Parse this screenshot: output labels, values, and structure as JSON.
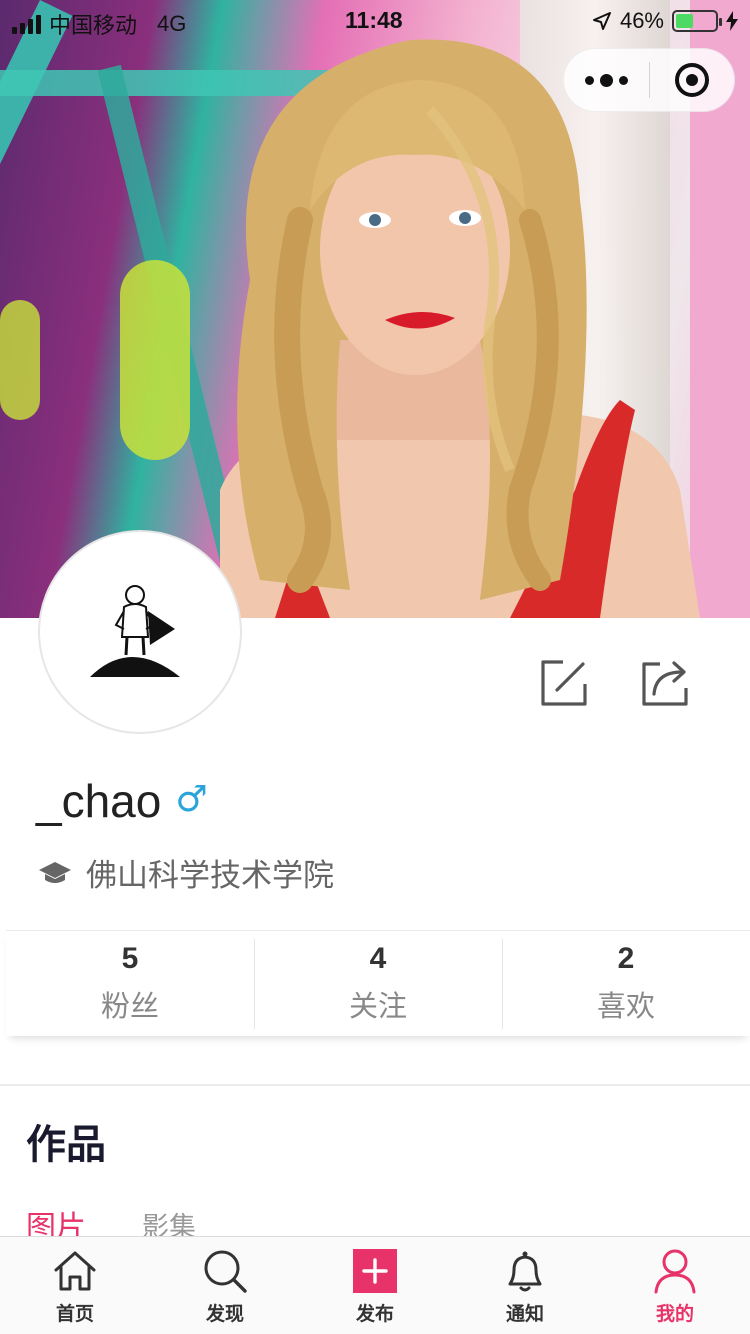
{
  "status_bar": {
    "carrier": "中国移动",
    "network": "4G",
    "time": "11:48",
    "battery_percent": "46%",
    "battery_level": 0.46
  },
  "capsule": {
    "more_icon": "more-dots-icon",
    "close_icon": "target-icon"
  },
  "profile": {
    "username": "_chao",
    "gender_symbol": "♂",
    "school": "佛山科学技术学院",
    "actions": {
      "edit_icon": "edit-icon",
      "share_icon": "share-icon"
    }
  },
  "stats": [
    {
      "value": "5",
      "label": "粉丝"
    },
    {
      "value": "4",
      "label": "关注"
    },
    {
      "value": "2",
      "label": "喜欢"
    }
  ],
  "works": {
    "title": "作品",
    "tabs": [
      "图片",
      "影集"
    ]
  },
  "tabbar": [
    {
      "label": "首页",
      "icon": "home-icon"
    },
    {
      "label": "发现",
      "icon": "search-icon"
    },
    {
      "label": "发布",
      "icon": "publish-icon"
    },
    {
      "label": "通知",
      "icon": "bell-icon"
    },
    {
      "label": "我的",
      "icon": "user-icon",
      "active": true
    }
  ],
  "colors": {
    "accent": "#e8336a",
    "gender": "#2aa4d9",
    "battery": "#4cd964"
  }
}
